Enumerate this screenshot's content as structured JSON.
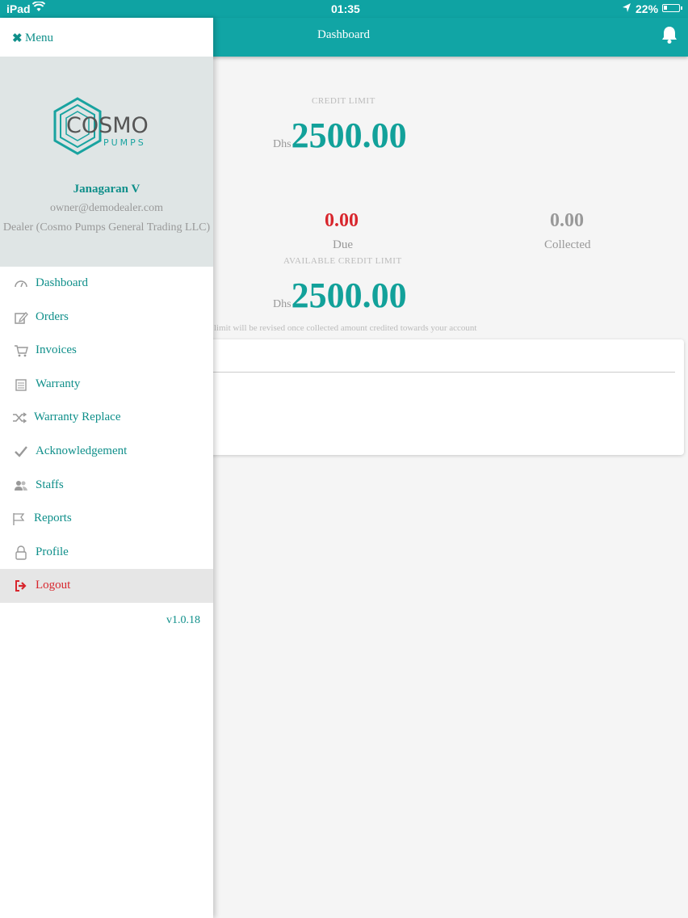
{
  "status": {
    "carrier": "iPad",
    "time": "01:35",
    "battery": "22%"
  },
  "navbar": {
    "title": "Dashboard"
  },
  "main": {
    "credit_limit_label": "CREDIT LIMIT",
    "currency": "Dhs",
    "credit_limit_value": "2500.00",
    "due_value": "0.00",
    "due_label": "Due",
    "collected_value": "0.00",
    "collected_label": "Collected",
    "available_label": "AVAILABLE CREDIT LIMIT",
    "available_value": "2500.00",
    "note": "it limit will be revised once collected amount credited towards your account"
  },
  "drawer": {
    "menu_label": "Menu",
    "logo_main": "COSMO",
    "logo_sub": "PUMPS",
    "user_name": "Janagaran V",
    "user_email": "owner@demodealer.com",
    "user_role": "Dealer (Cosmo Pumps General Trading LLC)",
    "items": [
      {
        "label": "Dashboard",
        "icon": "gauge-icon"
      },
      {
        "label": "Orders",
        "icon": "edit-icon"
      },
      {
        "label": "Invoices",
        "icon": "cart-icon"
      },
      {
        "label": "Warranty",
        "icon": "calendar-icon"
      },
      {
        "label": "Warranty Replace",
        "icon": "shuffle-icon"
      },
      {
        "label": "Acknowledgement",
        "icon": "check-icon"
      },
      {
        "label": "Staffs",
        "icon": "users-icon"
      },
      {
        "label": "Reports",
        "icon": "flag-icon"
      },
      {
        "label": "Profile",
        "icon": "lock-icon"
      },
      {
        "label": "Logout",
        "icon": "logout-icon"
      }
    ],
    "version": "v1.0.18"
  },
  "colors": {
    "teal": "#11a5a5",
    "due_red": "#d8262d",
    "collected_grey": "#999999"
  }
}
